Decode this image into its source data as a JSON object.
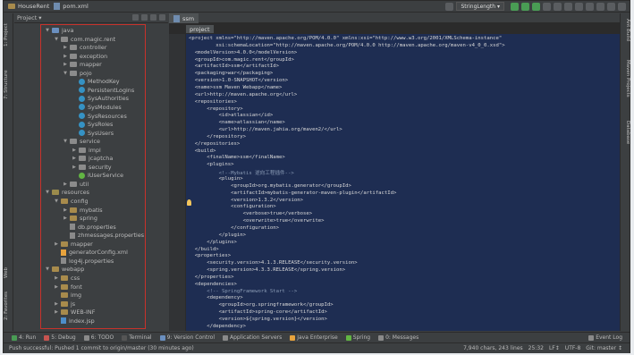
{
  "title_bar": {
    "project": "HouseRent",
    "file": "pom.xml"
  },
  "toolbar": {
    "run_config": "StringLength ▾"
  },
  "left_strip": {
    "project_tab": "1: Project",
    "structure_tab": "7: Structure",
    "web_tab": "Web",
    "favorites_tab": "2: Favorites"
  },
  "right_strip": {
    "ant_tab": "Ant Build",
    "maven_tab": "Maven Projects",
    "database_tab": "Database"
  },
  "project_panel": {
    "view_selector": "Project ▾"
  },
  "tree": [
    {
      "label": "java",
      "level": 0,
      "icon": "src",
      "arrow": "▼"
    },
    {
      "label": "com.magic.rent",
      "level": 1,
      "icon": "pkg",
      "arrow": "▼"
    },
    {
      "label": "controller",
      "level": 2,
      "icon": "pkg",
      "arrow": "▶"
    },
    {
      "label": "exception",
      "level": 2,
      "icon": "pkg",
      "arrow": "▶"
    },
    {
      "label": "mapper",
      "level": 2,
      "icon": "pkg",
      "arrow": "▶"
    },
    {
      "label": "pojo",
      "level": 2,
      "icon": "pkg",
      "arrow": "▼"
    },
    {
      "label": "MethodKey",
      "level": 3,
      "icon": "cls",
      "arrow": ""
    },
    {
      "label": "PersistentLogins",
      "level": 3,
      "icon": "cls",
      "arrow": ""
    },
    {
      "label": "SysAuthorities",
      "level": 3,
      "icon": "cls",
      "arrow": ""
    },
    {
      "label": "SysModules",
      "level": 3,
      "icon": "cls",
      "arrow": ""
    },
    {
      "label": "SysResources",
      "level": 3,
      "icon": "cls",
      "arrow": ""
    },
    {
      "label": "SysRoles",
      "level": 3,
      "icon": "cls",
      "arrow": ""
    },
    {
      "label": "SysUsers",
      "level": 3,
      "icon": "cls",
      "arrow": ""
    },
    {
      "label": "service",
      "level": 2,
      "icon": "pkg",
      "arrow": "▼"
    },
    {
      "label": "impl",
      "level": 3,
      "icon": "pkg",
      "arrow": "▶"
    },
    {
      "label": "jcaptcha",
      "level": 3,
      "icon": "pkg",
      "arrow": "▶"
    },
    {
      "label": "security",
      "level": 3,
      "icon": "pkg",
      "arrow": "▶"
    },
    {
      "label": "IUserService",
      "level": 3,
      "icon": "ifc",
      "arrow": ""
    },
    {
      "label": "util",
      "level": 2,
      "icon": "pkg",
      "arrow": "▶"
    },
    {
      "label": "resources",
      "level": 0,
      "icon": "res",
      "arrow": "▼"
    },
    {
      "label": "config",
      "level": 1,
      "icon": "folder",
      "arrow": "▼"
    },
    {
      "label": "mybatis",
      "level": 2,
      "icon": "folder",
      "arrow": "▶"
    },
    {
      "label": "spring",
      "level": 2,
      "icon": "folder",
      "arrow": "▶"
    },
    {
      "label": "db.properties",
      "level": 2,
      "icon": "prop",
      "arrow": ""
    },
    {
      "label": "zhmessages.properties",
      "level": 2,
      "icon": "prop",
      "arrow": ""
    },
    {
      "label": "mapper",
      "level": 1,
      "icon": "folder",
      "arrow": "▶"
    },
    {
      "label": "generatorConfig.xml",
      "level": 1,
      "icon": "xml",
      "arrow": ""
    },
    {
      "label": "log4j.properties",
      "level": 1,
      "icon": "prop",
      "arrow": ""
    },
    {
      "label": "webapp",
      "level": 0,
      "icon": "folder",
      "arrow": "▼"
    },
    {
      "label": "css",
      "level": 1,
      "icon": "folder",
      "arrow": "▶"
    },
    {
      "label": "font",
      "level": 1,
      "icon": "folder",
      "arrow": "▶"
    },
    {
      "label": "img",
      "level": 1,
      "icon": "folder",
      "arrow": ""
    },
    {
      "label": "js",
      "level": 1,
      "icon": "folder",
      "arrow": "▶"
    },
    {
      "label": "WEB-INF",
      "level": 1,
      "icon": "folder",
      "arrow": "▶"
    },
    {
      "label": "index.jsp",
      "level": 1,
      "icon": "jsp",
      "arrow": ""
    }
  ],
  "editor": {
    "tab": "ssm",
    "breadcrumb": "project",
    "lines": [
      "<project xmlns=\"http://maven.apache.org/POM/4.0.0\" xmlns:xsi=\"http://www.w3.org/2001/XMLSchema-instance\"",
      "         xsi:schemaLocation=\"http://maven.apache.org/POM/4.0.0 http://maven.apache.org/maven-v4_0_0.xsd\">",
      "  <modelVersion>4.0.0</modelVersion>",
      "  <groupId>com.magic.rent</groupId>",
      "  <artifactId>ssm</artifactId>",
      "  <packaging>war</packaging>",
      "  <version>1.0-SNAPSHOT</version>",
      "  <name>ssm Maven Webapp</name>",
      "  <url>http://maven.apache.org</url>",
      "  <repositories>",
      "      <repository>",
      "          <id>atlassian</id>",
      "          <name>atlassian</name>",
      "          <url>http://maven.jahia.org/maven2/</url>",
      "      </repository>",
      "  </repositories>",
      "  <build>",
      "      <finalName>ssm</finalName>",
      "      <plugins>",
      "          <!--Mybatis 逆向工程插件-->",
      "          <plugin>",
      "              <groupId>org.mybatis.generator</groupId>",
      "              <artifactId>mybatis-generator-maven-plugin</artifactId>",
      "              <version>1.3.2</version>",
      "              <configuration>",
      "                  <verbose>true</verbose>",
      "                  <overwrite>true</overwrite>",
      "              </configuration>",
      "          </plugin>",
      "      </plugins>",
      "  </build>",
      "  <properties>",
      "      <security.version>4.1.3.RELEASE</security.version>",
      "      <spring.version>4.3.3.RELEASE</spring.version>",
      "  </properties>",
      "  <dependencies>",
      "      <!-- SpringFramework Start -->",
      "      <dependency>",
      "          <groupId>org.springframework</groupId>",
      "          <artifactId>spring-core</artifactId>",
      "          <version>${spring.version}</version>",
      "      </dependency>"
    ]
  },
  "bottom_tools": [
    {
      "label": "4: Run",
      "color": "#499c54"
    },
    {
      "label": "5: Debug",
      "color": "#c75450"
    },
    {
      "label": "6: TODO",
      "color": "#8a8a8a"
    },
    {
      "label": "Terminal",
      "color": "#555555"
    },
    {
      "label": "9: Version Control",
      "color": "#6a8fbf"
    },
    {
      "label": "Application Servers",
      "color": "#8a8a8a"
    },
    {
      "label": "Java Enterprise",
      "color": "#e8a33d"
    },
    {
      "label": "Spring",
      "color": "#62b543"
    },
    {
      "label": "0: Messages",
      "color": "#8a8a8a"
    }
  ],
  "event_log": "Event Log",
  "status": {
    "message": "Push successful: Pushed 1 commit to origin/master (30 minutes ago)",
    "chars": "7,940 chars, 243 lines",
    "position": "25:32",
    "line_sep": "LF↕",
    "encoding": "UTF-8",
    "git": "Git: master ↕"
  }
}
